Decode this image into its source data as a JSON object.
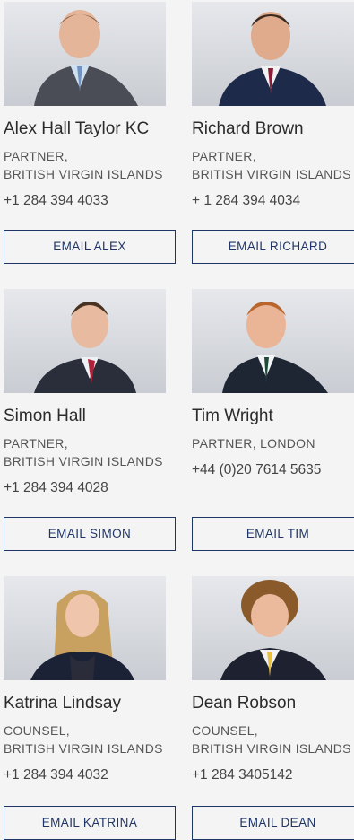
{
  "people": [
    {
      "name": "Alex Hall Taylor KC",
      "role_line1": "PARTNER,",
      "role_line2": "BRITISH VIRGIN ISLANDS",
      "phone": "+1 284 394 4033",
      "email_label": "EMAIL ALEX"
    },
    {
      "name": "Richard Brown",
      "role_line1": "PARTNER,",
      "role_line2": "BRITISH VIRGIN ISLANDS",
      "phone": "+ 1 284 394 4034",
      "email_label": "EMAIL RICHARD"
    },
    {
      "name": "Simon Hall",
      "role_line1": "PARTNER,",
      "role_line2": "BRITISH VIRGIN ISLANDS",
      "phone": "+1 284 394 4028",
      "email_label": "EMAIL SIMON"
    },
    {
      "name": "Tim Wright",
      "role_line1": "PARTNER,  LONDON",
      "role_line2": "",
      "phone": "+44 (0)20 7614 5635",
      "email_label": "EMAIL TIM"
    },
    {
      "name": "Katrina Lindsay",
      "role_line1": "COUNSEL,",
      "role_line2": "BRITISH VIRGIN ISLANDS",
      "phone": "+1 284 394 4032",
      "email_label": "EMAIL KATRINA"
    },
    {
      "name": "Dean Robson",
      "role_line1": "COUNSEL,",
      "role_line2": "BRITISH VIRGIN ISLANDS",
      "phone": "+1 284 3405142",
      "email_label": "EMAIL DEAN"
    }
  ],
  "colors": {
    "button_border": "#1f3566",
    "background": "#f4f4f4"
  }
}
